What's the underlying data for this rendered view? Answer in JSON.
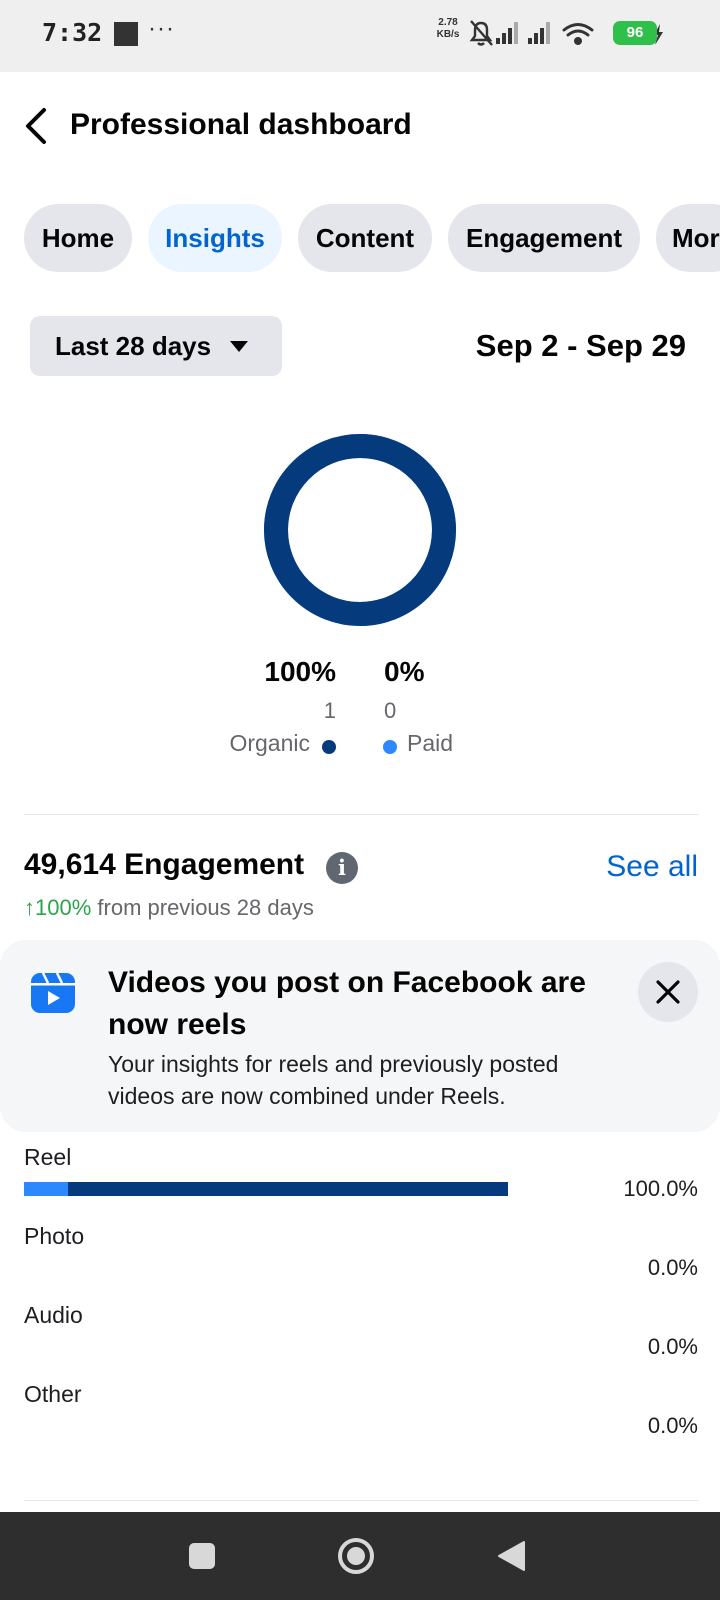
{
  "status_bar": {
    "time": "7:32",
    "net_speed_value": "2.78",
    "net_speed_unit": "KB/s",
    "battery": "96"
  },
  "header": {
    "title": "Professional dashboard"
  },
  "tabs": [
    {
      "label": "Home"
    },
    {
      "label": "Insights"
    },
    {
      "label": "Content"
    },
    {
      "label": "Engagement"
    },
    {
      "label": "Mor"
    }
  ],
  "date_filter": {
    "selected": "Last 28 days",
    "range": "Sep 2 - Sep 29"
  },
  "donut": {
    "organic": {
      "percent": "100%",
      "count": "1",
      "label": "Organic",
      "color": "#053a7d",
      "fraction": 1.0
    },
    "paid": {
      "percent": "0%",
      "count": "0",
      "label": "Paid",
      "color": "#2d88ff",
      "fraction": 0.0
    }
  },
  "engagement": {
    "title": "49,614 Engagement",
    "see_all": "See all",
    "change_arrow": "↑",
    "change_value": "100%",
    "change_suffix": " from previous 28 days"
  },
  "banner": {
    "title": "Videos you post on Facebook are now reels",
    "body": "Your insights for reels and previously posted videos are now combined under Reels."
  },
  "breakdown": [
    {
      "label": "Reel",
      "percent": "100.0%"
    },
    {
      "label": "Photo",
      "percent": "0.0%"
    },
    {
      "label": "Audio",
      "percent": "0.0%"
    },
    {
      "label": "Other",
      "percent": "0.0%"
    }
  ],
  "colors": {
    "accent": "#0064d1",
    "dark_blue": "#053a7d",
    "light_blue": "#2d88ff",
    "positive": "#31a24c"
  }
}
